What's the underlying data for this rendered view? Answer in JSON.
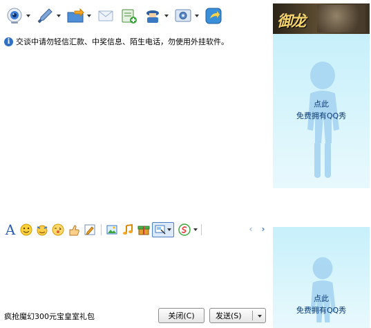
{
  "toolbar_top": {
    "buttons": [
      {
        "icon": "video-call-icon",
        "has_dropdown": true
      },
      {
        "icon": "voice-call-icon",
        "has_dropdown": true
      },
      {
        "icon": "send-file-icon",
        "has_dropdown": true
      },
      {
        "icon": "send-message-icon",
        "has_dropdown": false
      },
      {
        "icon": "add-to-list-icon",
        "has_dropdown": false
      },
      {
        "icon": "remote-assist-icon",
        "has_dropdown": true
      },
      {
        "icon": "settings-icon",
        "has_dropdown": true
      },
      {
        "icon": "share-icon",
        "has_dropdown": false
      }
    ]
  },
  "notice": {
    "text": "交谈中请勿轻信汇款、中奖信息、陌生电话，勿使用外挂软件。"
  },
  "side_panel": {
    "banner_logo_text": "御龙",
    "show_top": {
      "line1": "点此",
      "line2": "免费拥有QQ秀"
    },
    "show_bottom": {
      "line1": "点此",
      "line2": "免费拥有QQ秀"
    }
  },
  "format_toolbar": {
    "font_label": "A",
    "icons": [
      "smiley-icon",
      "magic-face-icon",
      "emoji-wink-icon",
      "thumb-icon",
      "handwriting-icon",
      "image-icon",
      "music-icon",
      "gift-icon",
      "screenshot-icon",
      "soso-icon"
    ]
  },
  "bottom": {
    "promo_text": "疯抢魔幻300元宝皇室礼包",
    "close_label": "关闭(C)",
    "send_label": "发送(S)"
  },
  "colors": {
    "accent_blue": "#2a5db5",
    "panel_bg": "#c7f0fb",
    "show_text": "#0a3a73"
  }
}
